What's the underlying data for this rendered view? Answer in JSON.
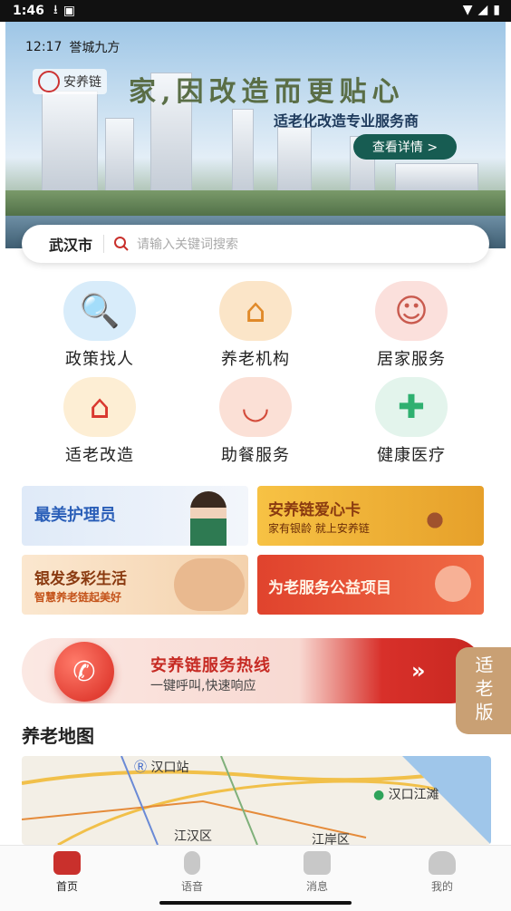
{
  "status_bar": {
    "time": "1:46"
  },
  "banner": {
    "inner_time": "12:17",
    "inner_text": "誉城九方",
    "logo_text": "安养链",
    "slogan": "家,因改造而更贴心",
    "subtitle": "适老化改造专业服务商",
    "button": "查看详情 >"
  },
  "search": {
    "city": "武汉市",
    "placeholder": "请输入关键词搜索"
  },
  "services": [
    {
      "label": "政策找人",
      "icon": "document-search-icon"
    },
    {
      "label": "养老机构",
      "icon": "house-icon"
    },
    {
      "label": "居家服务",
      "icon": "caregiver-icon"
    },
    {
      "label": "适老改造",
      "icon": "renovation-icon"
    },
    {
      "label": "助餐服务",
      "icon": "meal-bowl-icon"
    },
    {
      "label": "健康医疗",
      "icon": "medical-kit-icon"
    }
  ],
  "cards": {
    "nurse": "最美护理员",
    "love_card_title": "安养链爱心卡",
    "love_card_sub": "家有银龄 就上安养链",
    "silver_title": "银发多彩生活",
    "silver_sub": "智慧养老链起美好",
    "charity": "为老服务公益项目"
  },
  "hotline": {
    "title": "安养链服务热线",
    "subtitle": "一键呼叫,快速响应"
  },
  "elder_mode": "适老版",
  "map": {
    "title": "养老地图",
    "labels": [
      "汉口站",
      "汉口江滩",
      "江汉区",
      "江岸区"
    ]
  },
  "bottom_nav": [
    {
      "label": "首页",
      "icon": "home-icon"
    },
    {
      "label": "语音",
      "icon": "microphone-icon"
    },
    {
      "label": "消息",
      "icon": "message-icon"
    },
    {
      "label": "我的",
      "icon": "user-icon"
    }
  ],
  "colors": {
    "accent": "#c9302c",
    "hotline_text": "#c62a23",
    "elder_badge": "#c9a074"
  }
}
